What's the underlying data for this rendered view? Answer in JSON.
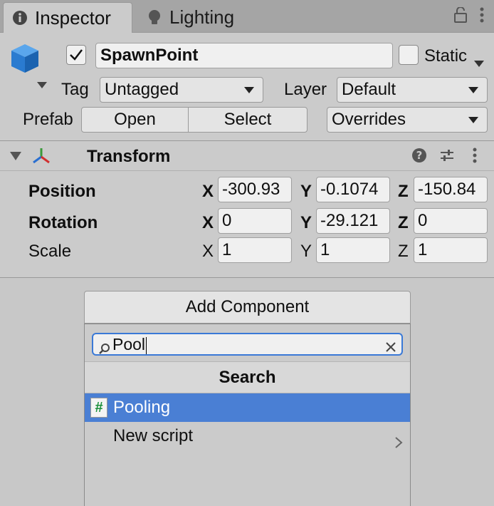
{
  "tabs": [
    {
      "label": "Inspector",
      "icon": "info-icon",
      "active": true
    },
    {
      "label": "Lighting",
      "icon": "bulb-icon",
      "active": false
    }
  ],
  "header": {
    "active": true,
    "name": "SpawnPoint",
    "static_label": "Static",
    "static_checked": false,
    "tag_label": "Tag",
    "tag_value": "Untagged",
    "layer_label": "Layer",
    "layer_value": "Default",
    "prefab_label": "Prefab",
    "open_label": "Open",
    "select_label": "Select",
    "overrides_label": "Overrides"
  },
  "transform": {
    "title": "Transform",
    "rows": [
      {
        "label": "Position",
        "x": "-300.93",
        "y": "-0.1074",
        "z": "-150.84"
      },
      {
        "label": "Rotation",
        "x": "0",
        "y": "-29.121",
        "z": "0"
      },
      {
        "label": "Scale",
        "x": "1",
        "y": "1",
        "z": "1"
      }
    ],
    "axes": {
      "x": "X",
      "y": "Y",
      "z": "Z"
    }
  },
  "add_component": {
    "button_label": "Add Component",
    "search_value": "Pool",
    "section_title": "Search",
    "results": [
      {
        "label": "Pooling",
        "icon": "script-icon",
        "selected": true
      },
      {
        "label": "New script",
        "icon": "",
        "selected": false
      }
    ]
  },
  "colors": {
    "selection": "#4a7fd4",
    "search_focus": "#3a79d7",
    "panel_bg": "#cbcbcb"
  }
}
